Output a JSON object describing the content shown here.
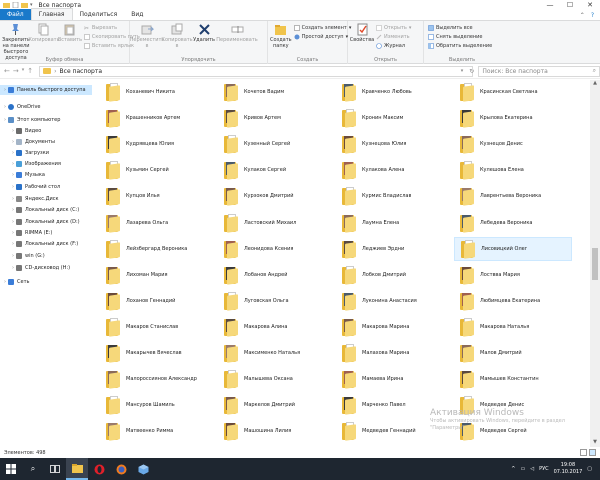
{
  "window": {
    "title": "Все паспорта",
    "controls": [
      "—",
      "☐",
      "✕"
    ]
  },
  "ribbon_tabs": [
    {
      "label": "Файл"
    },
    {
      "label": "Главная"
    },
    {
      "label": "Поделиться"
    },
    {
      "label": "Вид"
    }
  ],
  "ribbon": {
    "clipboard": {
      "pin_label": "Закрепить на панели быстрого доступа",
      "copy_label": "Копировать",
      "paste_label": "Вставить",
      "cut_label": "Вырезать",
      "copy_path_label": "Скопировать путь",
      "paste_shortcut_label": "Вставить ярлык",
      "group": "Буфер обмена"
    },
    "organize": {
      "move_label": "Переместить в",
      "copy_to_label": "Копировать в",
      "delete_label": "Удалить",
      "rename_label": "Переименовать",
      "group": "Упорядочить"
    },
    "new": {
      "new_folder_label": "Создать папку",
      "new_item_label": "Создать элемент",
      "easy_access_label": "Простой доступ",
      "group": "Создать"
    },
    "open": {
      "properties_label": "Свойства",
      "open_label": "Открыть",
      "edit_label": "Изменить",
      "history_label": "Журнал",
      "group": "Открыть"
    },
    "select": {
      "select_all_label": "Выделить все",
      "select_none_label": "Снять выделение",
      "invert_label": "Обратить выделение",
      "group": "Выделить"
    }
  },
  "address": {
    "path": "Все паспорта",
    "search_placeholder": "Поиск: Все паспорта"
  },
  "nav_pane": [
    {
      "label": "Панель быстрого доступа",
      "icon": "star-icon",
      "selected": true,
      "indent": 0
    },
    {
      "label": "OneDrive",
      "icon": "cloud-icon",
      "indent": 0
    },
    {
      "label": "Этот компьютер",
      "icon": "computer-icon",
      "indent": 0
    },
    {
      "label": "Видео",
      "icon": "video-icon",
      "indent": 1
    },
    {
      "label": "Документы",
      "icon": "documents-icon",
      "indent": 1
    },
    {
      "label": "Загрузки",
      "icon": "downloads-icon",
      "indent": 1
    },
    {
      "label": "Изображения",
      "icon": "pictures-icon",
      "indent": 1
    },
    {
      "label": "Музыка",
      "icon": "music-icon",
      "indent": 1
    },
    {
      "label": "Рабочий стол",
      "icon": "desktop-icon",
      "indent": 1
    },
    {
      "label": "Яндекс.Диск",
      "icon": "yandex-disk-icon",
      "indent": 1
    },
    {
      "label": "Локальный диск (C:)",
      "icon": "drive-icon",
      "indent": 1
    },
    {
      "label": "Локальный диск (D:)",
      "icon": "drive-icon",
      "indent": 1
    },
    {
      "label": "RIMMA (E:)",
      "icon": "drive-icon",
      "indent": 1
    },
    {
      "label": "Локальный диск (F:)",
      "icon": "drive-icon",
      "indent": 1
    },
    {
      "label": "win (G:)",
      "icon": "drive-icon",
      "indent": 1
    },
    {
      "label": "CD-дисковод (H:)",
      "icon": "cd-drive-icon",
      "indent": 1
    },
    {
      "label": "Сеть",
      "icon": "network-icon",
      "indent": 0
    }
  ],
  "folders": [
    [
      "Коханевич Никита",
      "Кочетов Вадим",
      "Кравченко Любовь",
      "Красинская Светлана"
    ],
    [
      "Крашенников Артем",
      "Кривов Артем",
      "Кронин Максим",
      "Крылова Екатерина"
    ],
    [
      "Кудрявцева Юлия",
      "Кузенный Сергей",
      "Кузнецова Юлия",
      "Кузнецов Денис"
    ],
    [
      "Кузьмин Сергей",
      "Кулаков Сергей",
      "Кулакова Алена",
      "Кулешова Елена"
    ],
    [
      "Купцов Илья",
      "Курзоков Дмитрий",
      "Курмис Владислав",
      "Лаврентьева Вероника"
    ],
    [
      "Лазарева Ольга",
      "Ластовский Михаил",
      "Лаумна Елена",
      "Лебедева Вероника"
    ],
    [
      "Лейзбергард Вероника",
      "Леонидова Ксения",
      "Леджиев Эрдни",
      "Лисовицкий Олег"
    ],
    [
      "Лихоман Мария",
      "Лобанов Андрей",
      "Лобков Дмитрий",
      "Лоствва Мария"
    ],
    [
      "Лоханов Геннадий",
      "Луговская Ольга",
      "Луконина Анастасия",
      "Любимцева Екатерина"
    ],
    [
      "Макаров Станислав",
      "Макарова Алина",
      "Макарова Марина",
      "Макарова Наталья"
    ],
    [
      "Макарычев Вячеслав",
      "Максименко Наталья",
      "Малахова Марина",
      "Малов Дмитрий"
    ],
    [
      "Малороссиянов Александр",
      "Малышева Оксана",
      "Мамаева Ирина",
      "Мамышев Константин"
    ],
    [
      "Мансуров Шамиль",
      "Маркелов Дмитрий",
      "Марченко Павел",
      "Медведев Денис"
    ],
    [
      "Матвеенко Римма",
      "Машошина Лилия",
      "Медведев Геннадий",
      "Медведев Сергей"
    ]
  ],
  "selected_folder": "Лисовицкий Олег",
  "status": {
    "count": "Элементов: 498"
  },
  "watermark": {
    "title": "Активация Windows",
    "text": "Чтобы активировать Windows, перейдите в раздел \"Параметры\"."
  },
  "taskbar": {
    "lang": "РУС",
    "time": "19:08",
    "date": "07.10.2017"
  },
  "colors": {
    "accent": "#1979ca",
    "selection": "#cce8ff",
    "taskbar": "#1e2630",
    "folder": "#f0c44c"
  }
}
